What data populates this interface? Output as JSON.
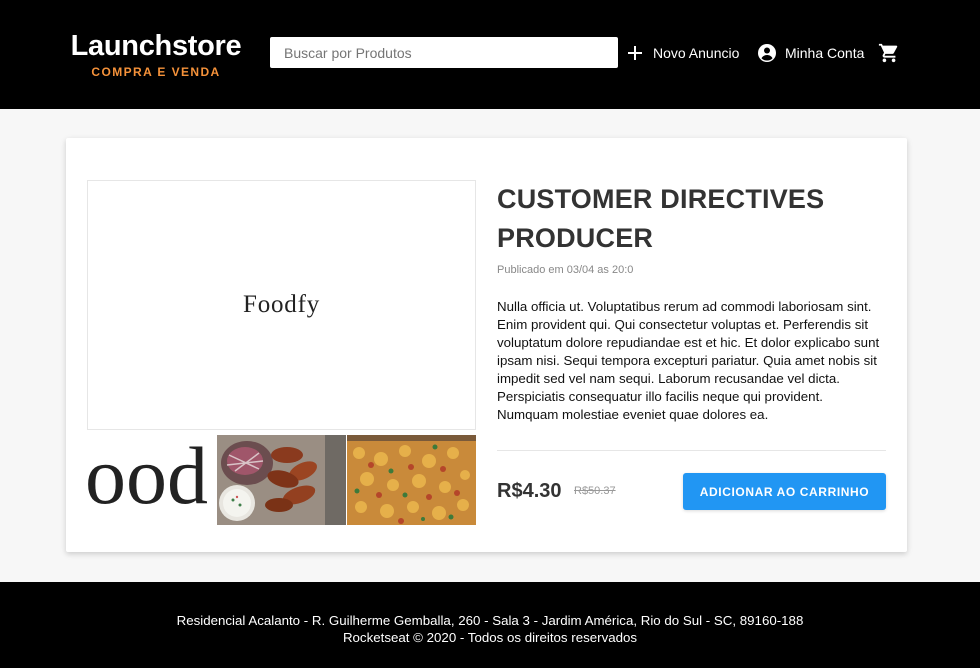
{
  "header": {
    "brand": "Launchstore",
    "tagline": "COMPRA E VENDA",
    "search_placeholder": "Buscar por Produtos",
    "new_ad_label": "Novo Anuncio",
    "account_label": "Minha Conta",
    "icons": [
      "add-icon",
      "account-circle-icon",
      "cart-icon"
    ]
  },
  "product": {
    "main_image_text": "Foodfy",
    "thumbnails": [
      {
        "kind": "text",
        "text": "ood"
      },
      {
        "kind": "photo",
        "icon": "chicken-wings-photo"
      },
      {
        "kind": "photo",
        "icon": "pasta-bake-photo"
      }
    ],
    "title": "CUSTOMER DIRECTIVES PRODUCER",
    "published": "Publicado em 03/04 as 20:0",
    "description": "Nulla officia ut. Voluptatibus rerum ad commodi laboriosam sint. Enim provident qui. Qui consectetur voluptas et. Perferendis sit voluptatum dolore repudiandae est et hic. Et dolor explicabo sunt ipsam nisi. Sequi tempora excepturi pariatur. Quia amet nobis sit impedit sed vel nam sequi. Laborum recusandae vel dicta. Perspiciatis consequatur illo facilis neque qui provident. Numquam molestiae eveniet quae dolores ea.",
    "price": "R$4.30",
    "old_price": "R$50.37",
    "buy_label": "ADICIONAR AO CARRINHO"
  },
  "footer": {
    "address": "Residencial Acalanto - R. Guilherme Gemballa, 260 - Sala 3 - Jardim América, Rio do Sul - SC, 89160-188",
    "copyright": "Rocketseat © 2020 - Todos os direitos reservados"
  },
  "colors": {
    "header_bg": "#000000",
    "accent_orange": "#f5923a",
    "button_blue": "#2196f3",
    "page_bg": "#f7f7f7"
  }
}
